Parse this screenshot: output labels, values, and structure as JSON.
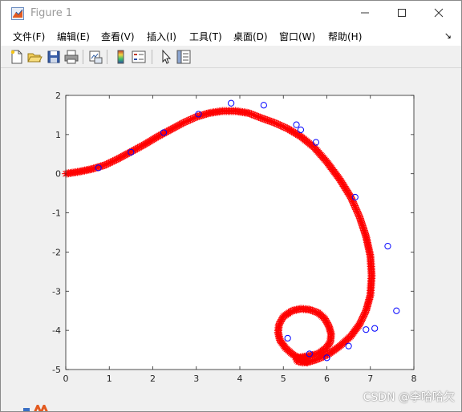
{
  "window": {
    "title": "Figure 1"
  },
  "menu": {
    "items": [
      {
        "label": "文件(F)"
      },
      {
        "label": "编辑(E)"
      },
      {
        "label": "查看(V)"
      },
      {
        "label": "插入(I)"
      },
      {
        "label": "工具(T)"
      },
      {
        "label": "桌面(D)"
      },
      {
        "label": "窗口(W)"
      },
      {
        "label": "帮助(H)"
      }
    ],
    "dock_glyph": "↘"
  },
  "toolbar": {
    "buttons": [
      "new-figure-icon",
      "open-file-icon",
      "save-icon",
      "print-icon",
      "link-plot-icon",
      "insert-colorbar-icon",
      "insert-legend-icon",
      "edit-plot-arrow-icon",
      "property-inspector-icon"
    ]
  },
  "colors": {
    "curve": "#ff0000",
    "points": "#0000ff",
    "axes_bg": "#ffffff",
    "figure_bg": "#f0f0f0"
  },
  "watermark": "CSDN @李哈哈欠",
  "chart_data": {
    "type": "scatter",
    "title": "",
    "xlabel": "",
    "ylabel": "",
    "xlim": [
      0,
      8
    ],
    "ylim": [
      -5,
      2
    ],
    "xticks": [
      "0",
      "1",
      "2",
      "3",
      "4",
      "5",
      "6",
      "7",
      "8"
    ],
    "yticks": [
      "2",
      "1",
      "0",
      "-1",
      "-2",
      "-3",
      "-4",
      "-5"
    ],
    "grid": false,
    "series": [
      {
        "marker": "*",
        "color": "#ff0000",
        "style": "dense asterisk markers forming a smooth curve",
        "x": [
          0.0,
          0.3,
          0.6,
          0.9,
          1.2,
          1.5,
          1.8,
          2.1,
          2.4,
          2.7,
          3.0,
          3.3,
          3.6,
          3.9,
          4.2,
          4.5,
          4.8,
          5.1,
          5.4,
          5.7,
          6.0,
          6.3,
          6.55,
          6.75,
          6.9,
          7.0,
          7.03,
          7.0,
          6.9,
          6.75,
          6.55,
          6.3,
          6.05,
          5.8,
          5.6,
          5.45,
          5.35,
          5.3,
          5.33,
          5.45,
          5.6,
          5.8,
          5.98,
          6.08,
          6.1,
          6.05,
          5.95,
          5.8,
          5.6,
          5.4,
          5.2,
          5.0,
          4.9,
          4.88,
          4.92,
          5.05,
          5.2,
          5.4,
          5.55
        ],
        "y": [
          0.0,
          0.05,
          0.12,
          0.22,
          0.38,
          0.56,
          0.74,
          0.94,
          1.12,
          1.3,
          1.45,
          1.55,
          1.6,
          1.6,
          1.55,
          1.42,
          1.3,
          1.15,
          0.95,
          0.68,
          0.3,
          -0.15,
          -0.6,
          -1.1,
          -1.6,
          -2.1,
          -2.6,
          -3.1,
          -3.5,
          -3.85,
          -4.15,
          -4.4,
          -4.6,
          -4.73,
          -4.8,
          -4.82,
          -4.8,
          -4.75,
          -4.7,
          -4.68,
          -4.65,
          -4.6,
          -4.45,
          -4.3,
          -4.1,
          -3.9,
          -3.7,
          -3.55,
          -3.47,
          -3.45,
          -3.5,
          -3.65,
          -3.85,
          -4.05,
          -4.25,
          -4.45,
          -4.6,
          -4.75,
          -4.82
        ]
      },
      {
        "marker": "o",
        "color": "#0000ff",
        "x": [
          0.75,
          1.5,
          2.25,
          3.05,
          3.8,
          4.55,
          5.3,
          5.4,
          5.75,
          6.65,
          7.4,
          7.6,
          7.1,
          6.9,
          6.5,
          6.0,
          5.6,
          5.1
        ],
        "y": [
          0.15,
          0.55,
          1.05,
          1.52,
          1.8,
          1.75,
          1.25,
          1.12,
          0.8,
          -0.6,
          -1.85,
          -3.5,
          -3.95,
          -3.98,
          -4.4,
          -4.7,
          -4.6,
          -4.2
        ]
      }
    ]
  }
}
